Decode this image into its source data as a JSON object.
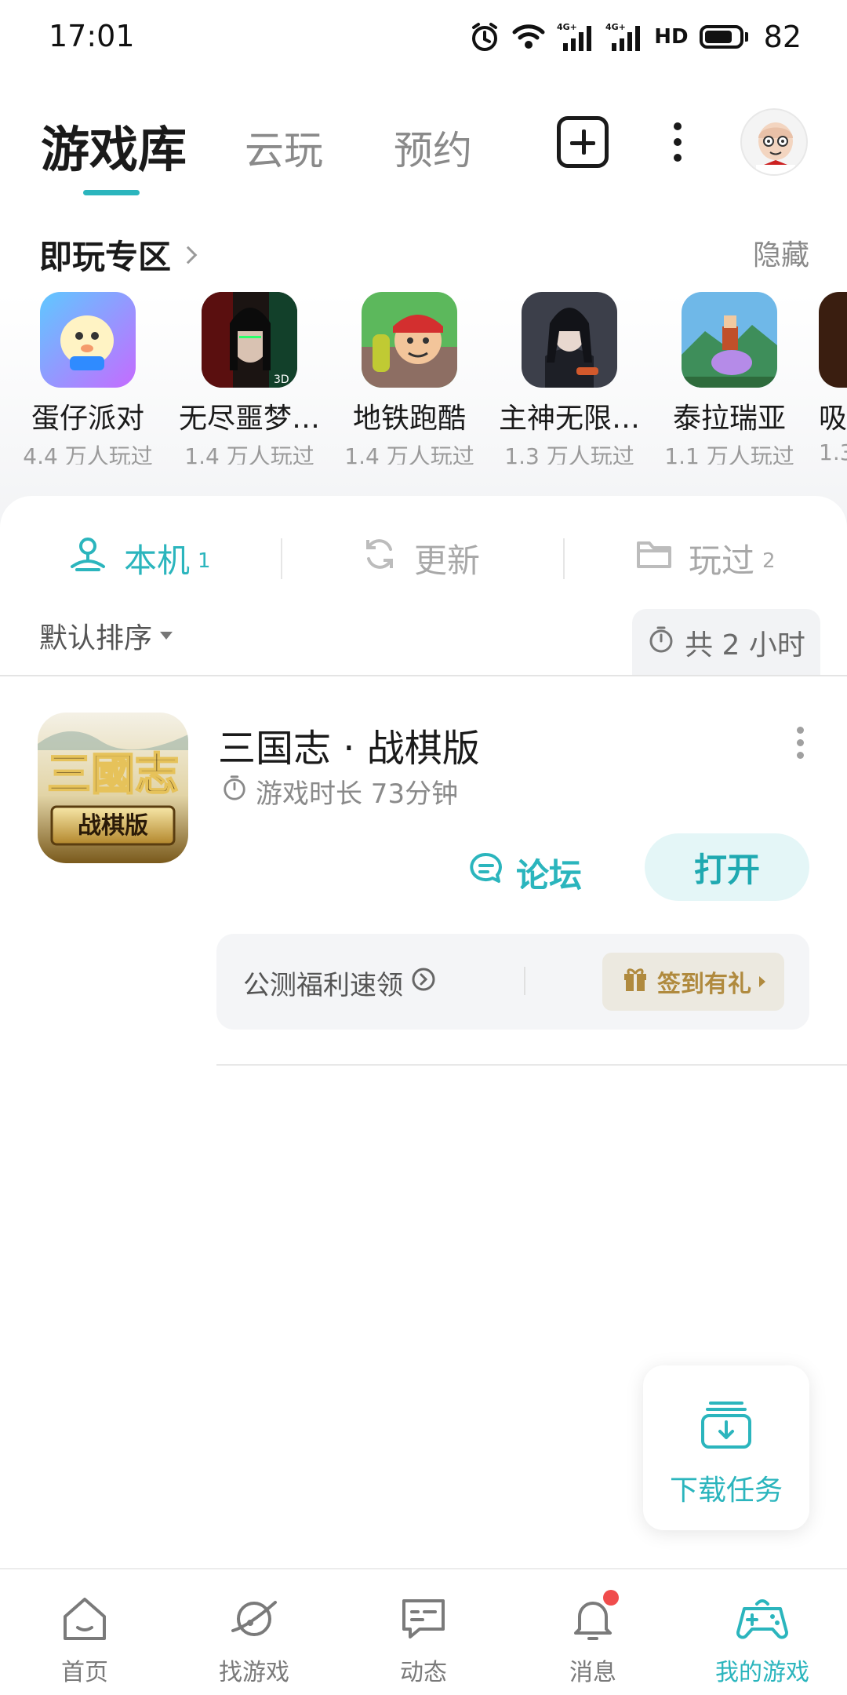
{
  "status_bar": {
    "time": "17:01",
    "network_1": "4G+",
    "network_2": "4G+",
    "hd": "HD",
    "battery": "82"
  },
  "header": {
    "tabs": [
      {
        "label": "游戏库",
        "active": true
      },
      {
        "label": "云玩",
        "active": false
      },
      {
        "label": "预约",
        "active": false
      }
    ],
    "add_icon": "plus-square-icon",
    "more_icon": "more-vertical-icon"
  },
  "quick_play": {
    "title": "即玩专区",
    "hide_label": "隐藏",
    "games": [
      {
        "name": "蛋仔派对",
        "count": "4.4 万人玩过"
      },
      {
        "name": "无尽噩梦…",
        "count": "1.4 万人玩过"
      },
      {
        "name": "地铁跑酷",
        "count": "1.4 万人玩过"
      },
      {
        "name": "主神无限…",
        "count": "1.3 万人玩过"
      },
      {
        "name": "泰拉瑞亚",
        "count": "1.1 万人玩过"
      },
      {
        "name": "吸",
        "count": "1.3"
      }
    ]
  },
  "segments": [
    {
      "label": "本机",
      "count": "1",
      "active": true,
      "icon": "user-pin-icon"
    },
    {
      "label": "更新",
      "count": "",
      "active": false,
      "icon": "refresh-icon"
    },
    {
      "label": "玩过",
      "count": "2",
      "active": false,
      "icon": "folder-icon"
    }
  ],
  "sort": {
    "label": "默认排序"
  },
  "total_time": "共 2 小时",
  "game_row": {
    "title": "三国志 · 战棋版",
    "icon_text_top": "三國志",
    "icon_text_bottom": "战棋版",
    "play_time": "游戏时长 73分钟",
    "forum_label": "论坛",
    "open_label": "打开",
    "promo_text": "公测福利速领",
    "signin_label": "签到有礼"
  },
  "download_fab": {
    "label": "下载任务"
  },
  "bottom_nav": [
    {
      "label": "首页",
      "icon": "home-icon",
      "active": false
    },
    {
      "label": "找游戏",
      "icon": "planet-icon",
      "active": false
    },
    {
      "label": "动态",
      "icon": "chat-icon",
      "active": false
    },
    {
      "label": "消息",
      "icon": "bell-icon",
      "active": false,
      "badge": true
    },
    {
      "label": "我的游戏",
      "icon": "gamepad-icon",
      "active": true
    }
  ],
  "colors": {
    "accent": "#2bb5bd",
    "badge": "#f04c4c",
    "gift": "#b08a3e"
  }
}
